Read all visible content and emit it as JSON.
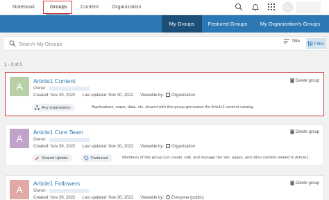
{
  "topnav": {
    "tabs": [
      "Notebook",
      "Groups",
      "Content",
      "Organization"
    ],
    "active": "Groups",
    "icons": [
      "search-icon",
      "bell-icon",
      "apps-grid-icon",
      "avatar-icon"
    ]
  },
  "band": {
    "tabs": [
      "My Groups",
      "Featured Groups",
      "My Organization's Groups"
    ],
    "active": "My Groups",
    "accent": "#2c78b4",
    "active_bg": "#1b4f78"
  },
  "search": {
    "placeholder": "Search My Groups",
    "sort_label": "Title",
    "filter_label": "Filter"
  },
  "result_count": "1 - 3 of 3",
  "groups": [
    {
      "thumb_letter": "A",
      "thumb_color": "#b9cfa8",
      "title": "Article1 Content",
      "owner_label": "Owner:",
      "created": "Created: Nov 30, 2022",
      "updated": "Last updated: Nov 30, 2022",
      "viewable_label": "Viewable by:",
      "viewable_value": "Organization",
      "delete_label": "Delete group",
      "chips": [
        "Any organization"
      ],
      "description": "Applications, maps, data, etc. shared with this group generates the Article1 content catalog."
    },
    {
      "thumb_letter": "A",
      "thumb_color": "#c1a2c9",
      "title": "Article1 Core Team",
      "owner_label": "Owner:",
      "created": "Created: Nov 30, 2022",
      "updated": "Last updated: Nov 30, 2022",
      "viewable_label": "Viewable by:",
      "viewable_value": "Organization",
      "delete_label": "Delete group",
      "chips": [
        "Shared Update",
        "Partnered"
      ],
      "description": "Members of this group can create, edit, and manage the site, pages, and other content related to Article1."
    },
    {
      "thumb_letter": "A",
      "thumb_color": "#e0a9a6",
      "title": "Article1 Followers",
      "owner_label": "Owner:",
      "created": "Created: Nov 30, 2022",
      "updated": "Last updated: Nov 30, 2022",
      "viewable_label": "Viewable by:",
      "viewable_value": "Everyone (public)",
      "delete_label": "Delete group"
    }
  ]
}
